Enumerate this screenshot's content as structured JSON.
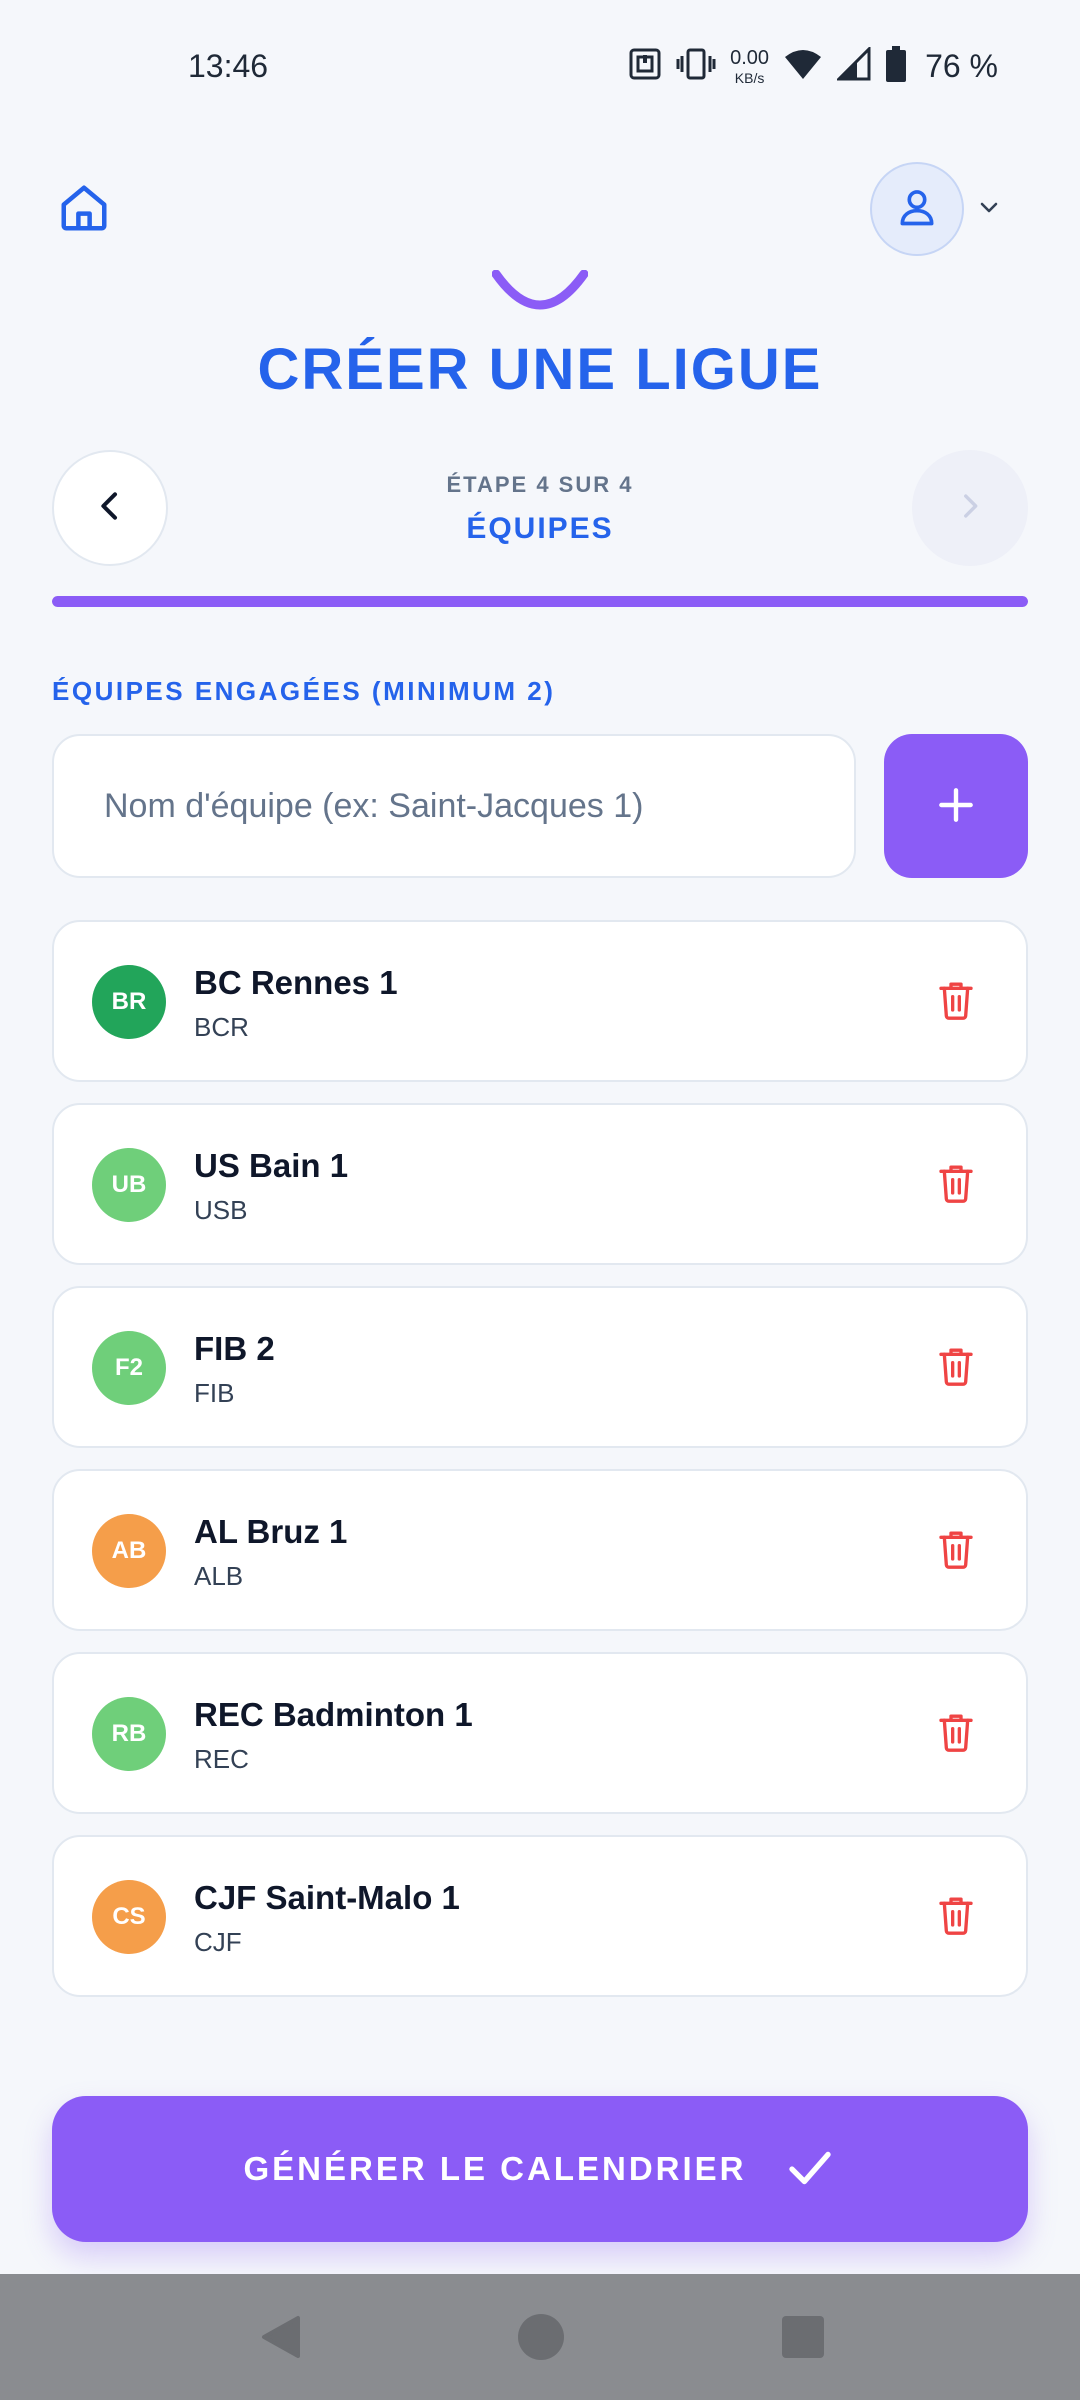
{
  "status_bar": {
    "time": "13:46",
    "net_speed_value": "0.00",
    "net_speed_unit": "KB/s",
    "battery_percent": "76 %",
    "icons": [
      "nfc-icon",
      "vibrate-icon",
      "wifi-icon",
      "signal-icon",
      "battery-icon"
    ]
  },
  "header": {
    "home_icon": "home-icon",
    "avatar_icon": "user-icon",
    "menu_icon": "chevron-down-icon"
  },
  "page": {
    "title": "CRÉER UNE LIGUE"
  },
  "stepper": {
    "step_count": "ÉTAPE 4 SUR 4",
    "step_name": "ÉQUIPES",
    "progress": 1.0,
    "back_icon": "chevron-left-icon",
    "next_icon": "chevron-right-icon"
  },
  "teams_section": {
    "label": "ÉQUIPES ENGAGÉES (MINIMUM 2)",
    "input_value": "",
    "input_placeholder": "Nom d'équipe (ex: Saint-Jacques 1)",
    "add_icon": "plus-icon"
  },
  "teams": [
    {
      "initials": "BR",
      "name": "BC Rennes 1",
      "code": "BCR",
      "color": "#22a55a"
    },
    {
      "initials": "UB",
      "name": "US Bain 1",
      "code": "USB",
      "color": "#6fcf7a"
    },
    {
      "initials": "F2",
      "name": "FIB 2",
      "code": "FIB",
      "color": "#6fcf7a"
    },
    {
      "initials": "AB",
      "name": "AL Bruz 1",
      "code": "ALB",
      "color": "#f59e4a"
    },
    {
      "initials": "RB",
      "name": "REC Badminton 1",
      "code": "REC",
      "color": "#6fcf7a"
    },
    {
      "initials": "CS",
      "name": "CJF Saint-Malo 1",
      "code": "CJF",
      "color": "#f59e4a"
    }
  ],
  "footer": {
    "generate_label": "GÉNÉRER LE CALENDRIER",
    "generate_icon": "check-icon"
  },
  "colors": {
    "primary_blue": "#2563eb",
    "accent_purple": "#8b5cf6",
    "delete_red": "#ef4444"
  }
}
